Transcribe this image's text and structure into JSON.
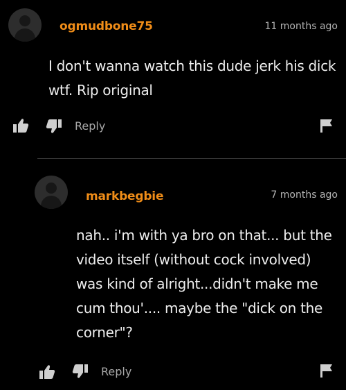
{
  "comments": [
    {
      "username": "ogmudbone75",
      "timestamp": "11 months ago",
      "text": "I don't wanna watch this dude jerk his dick wtf. Rip original",
      "reply_label": "Reply"
    },
    {
      "username": "markbegbie",
      "timestamp": "7 months ago",
      "text": "nah.. i'm with ya bro on that... but the video itself (without cock involved) was kind of alright...didn't make me cum thou'.... maybe the \"dick on the corner\"?",
      "reply_label": "Reply"
    }
  ],
  "colors": {
    "background": "#000000",
    "username": "#f08d18",
    "text": "#eeeeee",
    "muted": "#b3b3b3"
  },
  "icons": [
    "user-avatar",
    "thumbs-up-icon",
    "thumbs-down-icon",
    "flag-icon"
  ]
}
